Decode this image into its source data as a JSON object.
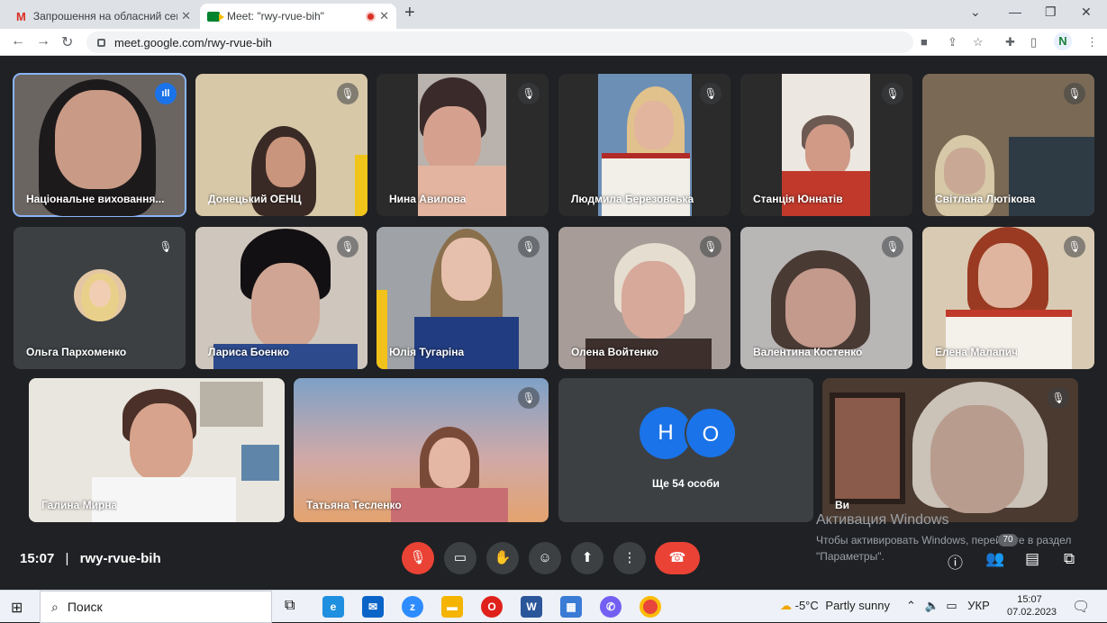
{
  "browser": {
    "tabs": [
      {
        "title": "Запрошення на обласний семі"
      },
      {
        "title": "Meet: \"rwy-rvue-bih\""
      }
    ],
    "url": "meet.google.com/rwy-rvue-bih",
    "profile": "N"
  },
  "participants": [
    {
      "name": "Національне виховання..."
    },
    {
      "name": "Донецький ОЕНЦ"
    },
    {
      "name": "Нина Авилова"
    },
    {
      "name": "Людмила Березовська"
    },
    {
      "name": "Станція Юннатів"
    },
    {
      "name": "Світлана Лютікова"
    },
    {
      "name": "Ольга Пархоменко"
    },
    {
      "name": "Лариса Боенко"
    },
    {
      "name": "Юлія Тугаріна"
    },
    {
      "name": "Олена Войтенко"
    },
    {
      "name": "Валентина Костенко"
    },
    {
      "name": "Елена Малапич"
    },
    {
      "name": "Галина Мирна"
    },
    {
      "name": "Татьяна Тесленко"
    },
    {
      "name": "Ви"
    }
  ],
  "more": {
    "initials": [
      "Н",
      "О"
    ],
    "label": "Ще 54 особи"
  },
  "meeting": {
    "time": "15:07",
    "separator": "|",
    "code": "rwy-rvue-bih",
    "participants_count": "70"
  },
  "activation": {
    "title": "Активация Windows",
    "text": "Чтобы активировать Windows, перейдите в раздел \"Параметры\"."
  },
  "taskbar": {
    "search": "Поиск",
    "weather_temp": "-5°C",
    "weather_text": "Partly sunny",
    "lang": "УКР",
    "time": "15:07",
    "date": "07.02.2023"
  },
  "colors": {
    "accent": "#1a73e8",
    "danger": "#ea4335",
    "stage": "#202124"
  }
}
